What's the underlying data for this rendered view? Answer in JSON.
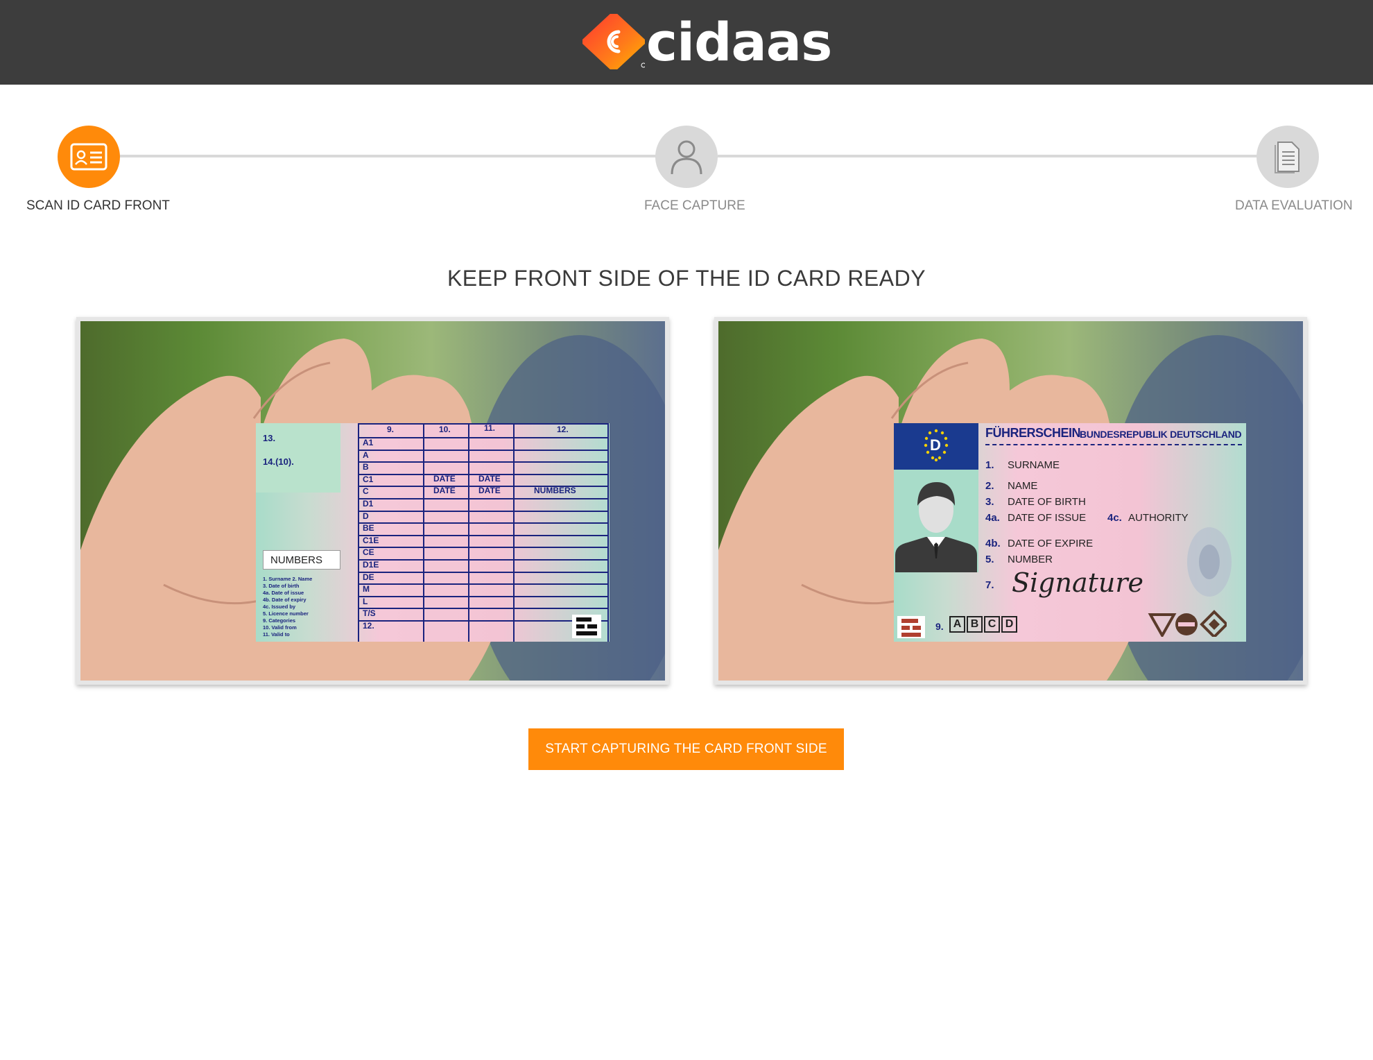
{
  "header": {
    "brand": "cidaas",
    "brand_mark": "registered"
  },
  "steps": [
    {
      "label": "SCAN ID CARD FRONT",
      "icon": "id-card-icon",
      "state": "active"
    },
    {
      "label": "FACE CAPTURE",
      "icon": "person-icon",
      "state": "inactive"
    },
    {
      "label": "DATA EVALUATION",
      "icon": "document-icon",
      "state": "inactive"
    }
  ],
  "main": {
    "title": "KEEP FRONT SIDE OF THE ID CARD READY",
    "cta_label": "START CAPTURING THE CARD FRONT SIDE"
  },
  "card_back": {
    "field13": "13.",
    "field14": "14.(10).",
    "col_headers": [
      "9.",
      "10.",
      "11.",
      "12."
    ],
    "categories": [
      "A1",
      "A",
      "B",
      "C1",
      "C",
      "D1",
      "D",
      "BE",
      "C1E",
      "CE",
      "D1E",
      "DE",
      "M",
      "L",
      "T/S",
      "12."
    ],
    "date_label": "DATE",
    "numbers_label": "NUMBERS",
    "legend": [
      "1. Surname  2. Name",
      "3. Date of birth",
      "4a. Date of issue",
      "4b. Date of expiry",
      "4c. Issued by",
      "5. Licence number",
      "9. Categories",
      "10. Valid from",
      "11. Valid to"
    ]
  },
  "card_front": {
    "country_code": "D",
    "title": "FÜHRERSCHEIN",
    "country": "BUNDESREPUBLIK DEUTSCHLAND",
    "fields": [
      {
        "num": "1.",
        "label": "SURNAME"
      },
      {
        "num": "2.",
        "label": "NAME"
      },
      {
        "num": "3.",
        "label": "DATE OF BIRTH"
      },
      {
        "num": "4a.",
        "label": "DATE OF ISSUE"
      },
      {
        "num": "4c.",
        "label": "AUTHORITY"
      },
      {
        "num": "4b.",
        "label": "DATE OF EXPIRE"
      },
      {
        "num": "5.",
        "label": "NUMBER"
      },
      {
        "num": "7.",
        "label": "Signature"
      }
    ],
    "field9": "9.",
    "category_boxes": [
      "A",
      "B",
      "C",
      "D"
    ]
  },
  "colors": {
    "accent": "#ff8a0a",
    "topbar": "#3d3d3d",
    "step_inactive": "#d9d9d9",
    "card_text": "#1a237e"
  }
}
